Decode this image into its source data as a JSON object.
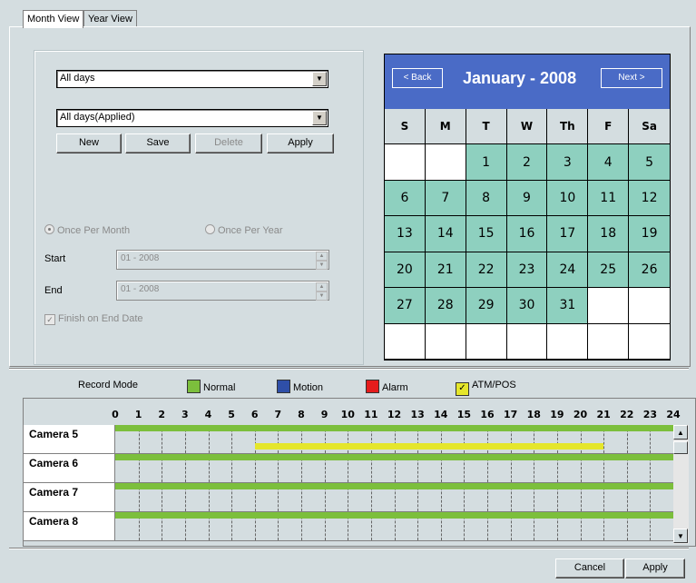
{
  "tabs": [
    {
      "label": "Month View",
      "active": true
    },
    {
      "label": "Year View",
      "active": false
    }
  ],
  "filters": {
    "select1_value": "All days",
    "select2_value": "All days(Applied)"
  },
  "buttons": {
    "new": "New",
    "save": "Save",
    "delete": "Delete",
    "apply": "Apply"
  },
  "schedule": {
    "once_per_month": "Once Per Month",
    "once_per_year": "Once Per Year",
    "start_label": "Start",
    "start_value": "01 - 2008",
    "end_label": "End",
    "end_value": "01 - 2008",
    "finish_label": "Finish on End Date"
  },
  "calendar": {
    "back_label": "< Back",
    "next_label": "Next >",
    "title": "January - 2008",
    "weekdays": [
      "S",
      "M",
      "T",
      "W",
      "Th",
      "F",
      "Sa"
    ],
    "weeks": [
      [
        "",
        "",
        "1",
        "2",
        "3",
        "4",
        "5"
      ],
      [
        "6",
        "7",
        "8",
        "9",
        "10",
        "11",
        "12"
      ],
      [
        "13",
        "14",
        "15",
        "16",
        "17",
        "18",
        "19"
      ],
      [
        "20",
        "21",
        "22",
        "23",
        "24",
        "25",
        "26"
      ],
      [
        "27",
        "28",
        "29",
        "30",
        "31",
        "",
        ""
      ],
      [
        "",
        "",
        "",
        "",
        "",
        "",
        ""
      ]
    ],
    "day_color": "#8ed0bf",
    "header_color": "#4a6bc6"
  },
  "legend": {
    "title": "Record Mode",
    "items": [
      {
        "label": "Normal",
        "color": "#7cbf3c"
      },
      {
        "label": "Motion",
        "color": "#2f4fa8"
      },
      {
        "label": "Alarm",
        "color": "#e51c1c"
      },
      {
        "label": "ATM/POS",
        "color": "#e5e62b",
        "checked": true
      }
    ]
  },
  "timeline": {
    "hours": [
      "0",
      "1",
      "2",
      "3",
      "4",
      "5",
      "6",
      "7",
      "8",
      "9",
      "10",
      "11",
      "12",
      "13",
      "14",
      "15",
      "16",
      "17",
      "18",
      "19",
      "20",
      "21",
      "22",
      "23",
      "24"
    ],
    "rows": [
      {
        "label": "Camera 5",
        "normal": [
          0,
          24
        ],
        "atm": [
          6,
          21
        ]
      },
      {
        "label": "Camera 6",
        "normal": [
          0,
          24
        ]
      },
      {
        "label": "Camera 7",
        "normal": [
          0,
          24
        ]
      },
      {
        "label": "Camera 8",
        "normal": [
          0,
          24
        ]
      }
    ]
  },
  "footer": {
    "cancel": "Cancel",
    "apply": "Apply"
  }
}
